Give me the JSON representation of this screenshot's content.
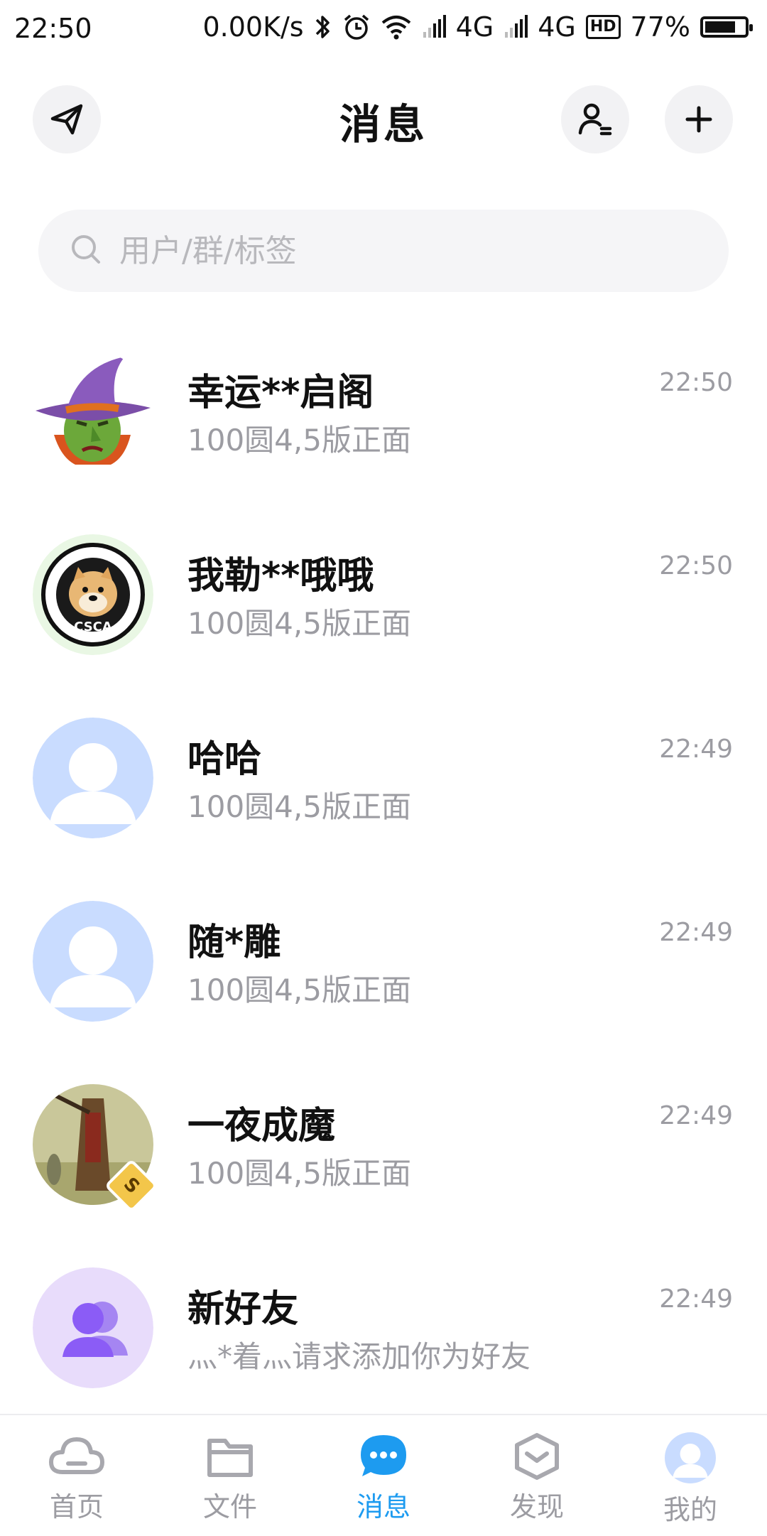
{
  "status_bar": {
    "time": "22:50",
    "speed": "0.00K/s",
    "net1": "4G",
    "net2": "4G",
    "hd": "HD",
    "battery": "77%",
    "battery_level": 0.77
  },
  "header": {
    "title": "消息"
  },
  "search": {
    "placeholder": "用户/群/标签"
  },
  "conversations": [
    {
      "name": "幸运**启阁",
      "preview": "100圆4,5版正面",
      "time": "22:50",
      "avatar": "witch-avatar"
    },
    {
      "name": "我勒**哦哦",
      "preview": "100圆4,5版正面",
      "time": "22:50",
      "avatar": "doge-badge-avatar"
    },
    {
      "name": "哈哈",
      "preview": "100圆4,5版正面",
      "time": "22:49",
      "avatar": "default-user-avatar"
    },
    {
      "name": "随*雕",
      "preview": "100圆4,5版正面",
      "time": "22:49",
      "avatar": "default-user-avatar"
    },
    {
      "name": "一夜成魔",
      "preview": "100圆4,5版正面",
      "time": "22:49",
      "avatar": "painting-avatar",
      "badge": "S"
    },
    {
      "name": "新好友",
      "preview": "灬*着灬请求添加你为好友",
      "time": "22:49",
      "avatar": "new-friend-avatar"
    }
  ],
  "bottom_nav": {
    "items": [
      {
        "label": "首页",
        "icon": "cloud-icon",
        "active": false
      },
      {
        "label": "文件",
        "icon": "folder-icon",
        "active": false
      },
      {
        "label": "消息",
        "icon": "chat-icon",
        "active": true
      },
      {
        "label": "发现",
        "icon": "discover-icon",
        "active": false
      },
      {
        "label": "我的",
        "icon": "profile-avatar-icon",
        "active": false
      }
    ]
  },
  "colors": {
    "accent": "#1d9bf0",
    "muted_text": "#9c9ca2",
    "default_avatar_bg": "#c9dcff",
    "new_friend_bg": "#e8dcfb",
    "new_friend_icon": "#8b5cf6"
  }
}
